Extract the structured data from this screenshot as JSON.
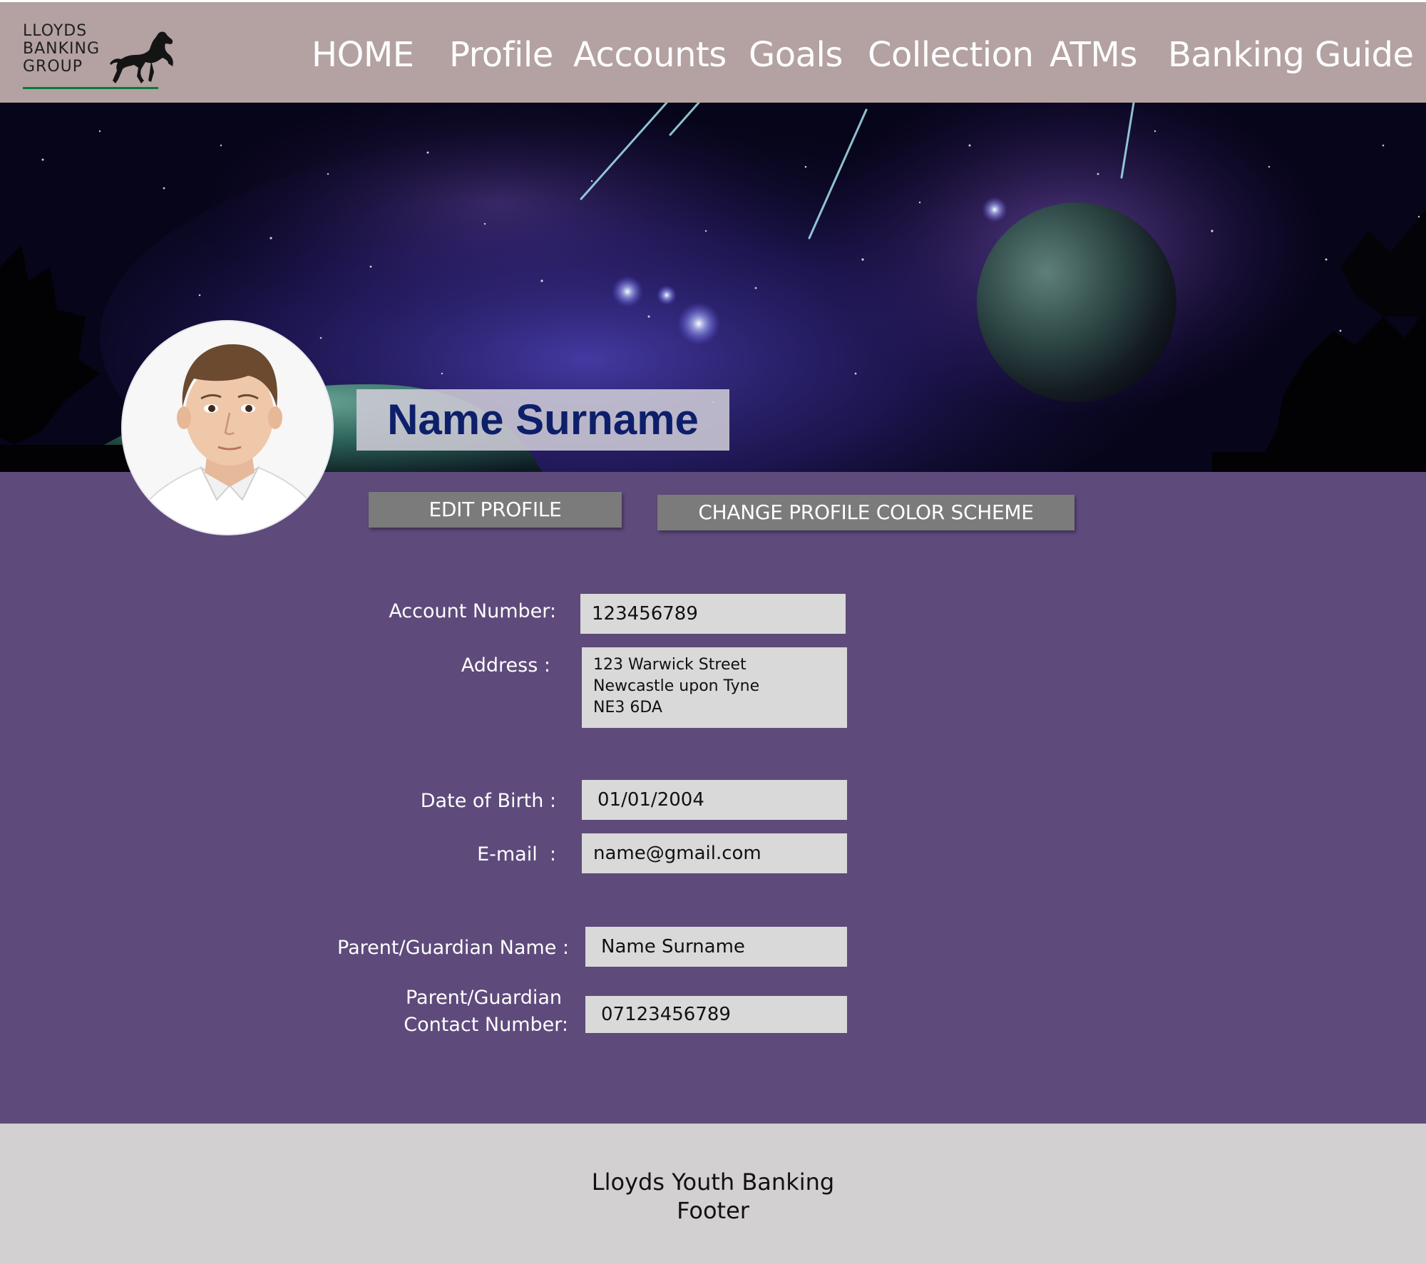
{
  "brand": {
    "logo_text": "LLOYDS\nBANKING\nGROUP",
    "logo_icon": "black-horse-icon",
    "accent_color": "#0b7a3a"
  },
  "nav": {
    "items": [
      "HOME",
      "Profile",
      "Accounts",
      "Goals",
      "Collection",
      "ATMs",
      "Banking Guide"
    ]
  },
  "profile": {
    "display_name": "Name Surname",
    "edit_button": "EDIT PROFILE",
    "color_scheme_button": "CHANGE PROFILE COLOR SCHEME"
  },
  "fields": {
    "account_number": {
      "label": "Account Number:",
      "value": "123456789"
    },
    "address": {
      "label": "Address :",
      "lines": [
        "123 Warwick Street",
        "Newcastle upon Tyne",
        "NE3 6DA"
      ]
    },
    "dob": {
      "label": "Date of Birth :",
      "value": "01/01/2004"
    },
    "email": {
      "label": "E-mail  :",
      "value": "name@gmail.com"
    },
    "guardian_name": {
      "label": "Parent/Guardian Name :",
      "value": "Name Surname"
    },
    "guardian_contact": {
      "label_line1": "Parent/Guardian",
      "label_line2": "Contact Number:",
      "value": "07123456789"
    }
  },
  "footer": {
    "line1": "Lloyds Youth Banking",
    "line2": "Footer"
  },
  "colors": {
    "header_bg": "#b3a2a1",
    "main_bg": "#5e4a7b",
    "footer_bg": "#d2d0d1",
    "button_bg": "#7b7b7b",
    "name_text": "#0e1f6a"
  }
}
